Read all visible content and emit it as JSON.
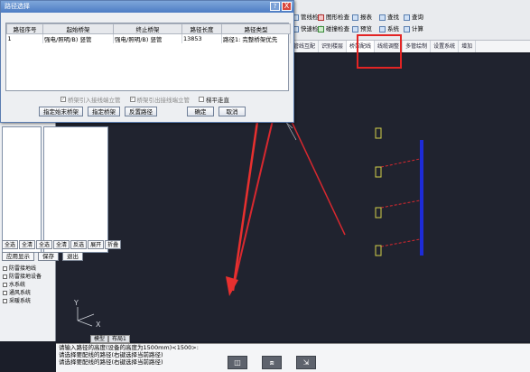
{
  "ribbon": {
    "row1": [
      "管线检查",
      "图形检查",
      "报表",
      "查找",
      "查询"
    ],
    "row2": [
      "快速检查",
      "碰撞检查",
      "预览",
      "系统",
      "计算"
    ],
    "tabs": [
      "管线互配",
      "识别楼层",
      "桥架配线",
      "线缆调整",
      "多管绘制",
      "设置系统",
      "增加"
    ],
    "active_tab": "桥架配线"
  },
  "dialog": {
    "title": "路径选择",
    "help_glyph": "?",
    "close_glyph": "X",
    "columns": [
      "路径序号",
      "起始桥架",
      "终止桥架",
      "路径长度",
      "路径类型"
    ],
    "rows": [
      [
        "1",
        "强电/照明/B) 竖管",
        "强电/照明/B) 竖管",
        "13853",
        "路径1: 完整桥架优先"
      ]
    ],
    "checks": [
      {
        "label": "桥架引入接线端立管",
        "checked": true
      },
      {
        "label": "桥架引出接线端立管",
        "checked": true
      },
      {
        "label": "梯平走直",
        "checked": false
      }
    ],
    "buttons": [
      "指定始末桥架",
      "指定桥架",
      "反置路径",
      "确定",
      "取消"
    ]
  },
  "left_panel": {
    "select_buttons": [
      "全选",
      "全清",
      "全选",
      "全清",
      "反选",
      "展开",
      "折叠"
    ],
    "action_buttons": [
      "应用显示",
      "保存",
      "退出"
    ],
    "tree": [
      "防雷接地线",
      "防雷接地设备",
      "水系统",
      "通风系统",
      "采暖系统"
    ]
  },
  "layout_tabs": [
    "模型",
    "布局1"
  ],
  "command_lines": [
    "请输入路径的高度(设备的高度为1500mm)<1500>:",
    "请选择要配线的路径(右键选择当前路径)",
    "",
    "请选择要配线的路径(右键选择当前路径)"
  ],
  "command_buttons": [
    "◫",
    "⧈",
    "⇲"
  ],
  "colors": {
    "canvas": "#20232f",
    "highlight": "#e32424",
    "cad_yellow": "#d4d24a",
    "cad_blue": "#1d2bd8",
    "cad_red": "#d8282f"
  }
}
